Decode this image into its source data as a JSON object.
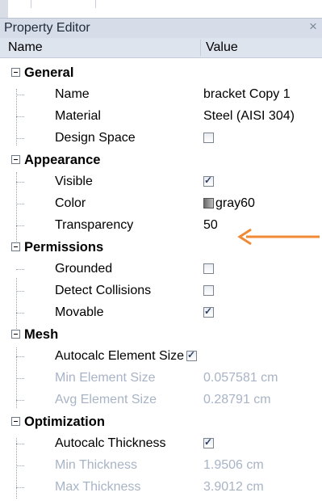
{
  "window": {
    "title": "Property Editor",
    "close_glyph": "×"
  },
  "columns": {
    "name": "Name",
    "value": "Value"
  },
  "sections": {
    "general": {
      "label": "General",
      "name_label": "Name",
      "name_value": "bracket Copy 1",
      "material_label": "Material",
      "material_value": "Steel (AISI 304)",
      "design_space_label": "Design Space",
      "design_space_checked": false
    },
    "appearance": {
      "label": "Appearance",
      "visible_label": "Visible",
      "visible_checked": true,
      "color_label": "Color",
      "color_value": "gray60",
      "color_swatch_hex": "#999999",
      "transparency_label": "Transparency",
      "transparency_value": "50"
    },
    "permissions": {
      "label": "Permissions",
      "grounded_label": "Grounded",
      "grounded_checked": false,
      "detect_collisions_label": "Detect Collisions",
      "detect_collisions_checked": false,
      "movable_label": "Movable",
      "movable_checked": true
    },
    "mesh": {
      "label": "Mesh",
      "autocalc_label": "Autocalc Element Size",
      "autocalc_checked": true,
      "min_label": "Min Element Size",
      "min_value": "0.057581 cm",
      "avg_label": "Avg Element Size",
      "avg_value": "0.28791 cm"
    },
    "optimization": {
      "label": "Optimization",
      "autocalc_label": "Autocalc Thickness",
      "autocalc_checked": true,
      "min_label": "Min Thickness",
      "min_value": "1.9506 cm",
      "max_label": "Max Thickness",
      "max_value": "3.9012 cm"
    }
  },
  "colors": {
    "annotation_arrow": "#f08a35",
    "disabled_text": "#a8b4c6",
    "header_bg": "#dde4ee"
  }
}
